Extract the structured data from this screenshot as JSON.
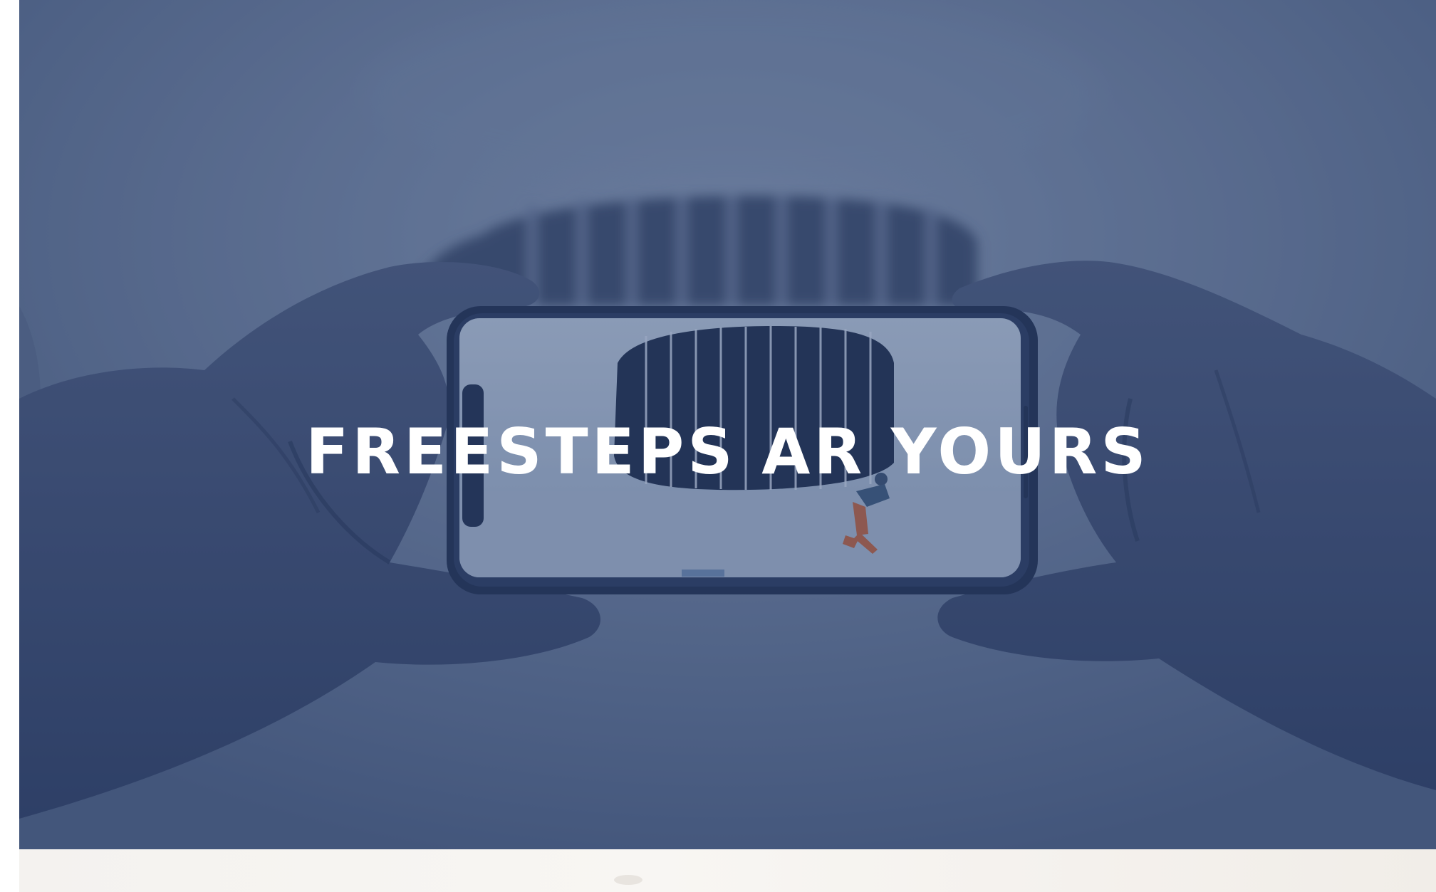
{
  "hero": {
    "title": "FREESTEPS AR YOURS",
    "image_alt": "Two hands holding a smartphone horizontally, capturing an augmented-reality scene",
    "overlay_color": "#2f4b7c"
  },
  "theme": {
    "text_color": "#ffffff",
    "next_section_color": "#f6f4f1"
  }
}
